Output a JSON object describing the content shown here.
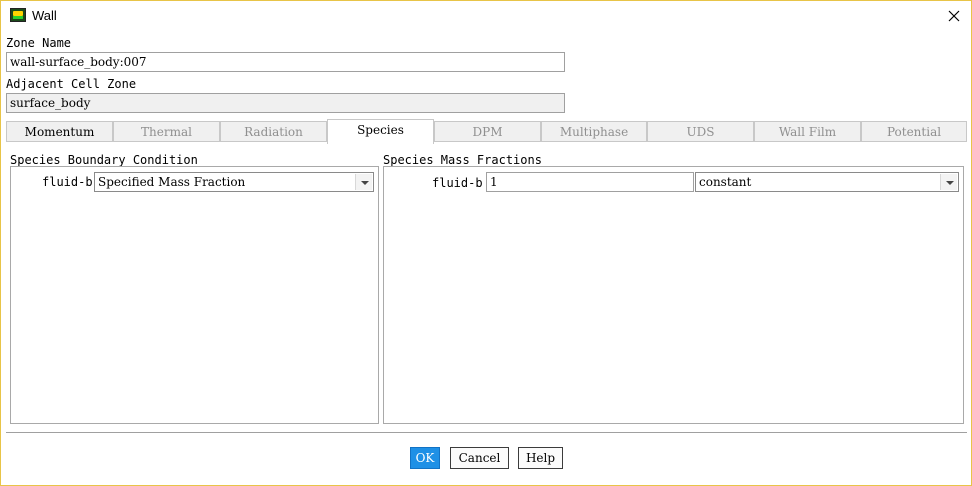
{
  "window": {
    "title": "Wall",
    "icon": "fluent-app-icon"
  },
  "zone_name": {
    "label": "Zone Name",
    "value": "wall-surface_body:007"
  },
  "adjacent_cell_zone": {
    "label": "Adjacent Cell Zone",
    "value": "surface_body"
  },
  "tabs": [
    {
      "label": "Momentum",
      "state": "enabled"
    },
    {
      "label": "Thermal",
      "state": "disabled"
    },
    {
      "label": "Radiation",
      "state": "disabled"
    },
    {
      "label": "Species",
      "state": "active"
    },
    {
      "label": "DPM",
      "state": "disabled"
    },
    {
      "label": "Multiphase",
      "state": "disabled"
    },
    {
      "label": "UDS",
      "state": "disabled"
    },
    {
      "label": "Wall Film",
      "state": "disabled"
    },
    {
      "label": "Potential",
      "state": "disabled"
    }
  ],
  "species_bc": {
    "title": "Species Boundary Condition",
    "rows": [
      {
        "label": "fluid-b",
        "value": "Specified Mass Fraction"
      }
    ]
  },
  "species_mass_fractions": {
    "title": "Species Mass Fractions",
    "rows": [
      {
        "label": "fluid-b",
        "value": "1",
        "method": "constant"
      }
    ]
  },
  "buttons": {
    "ok": "OK",
    "cancel": "Cancel",
    "help": "Help"
  },
  "colors": {
    "accent": "#1e90e6",
    "window_border": "#e8c447",
    "disabled_text": "#8f8f8f"
  }
}
